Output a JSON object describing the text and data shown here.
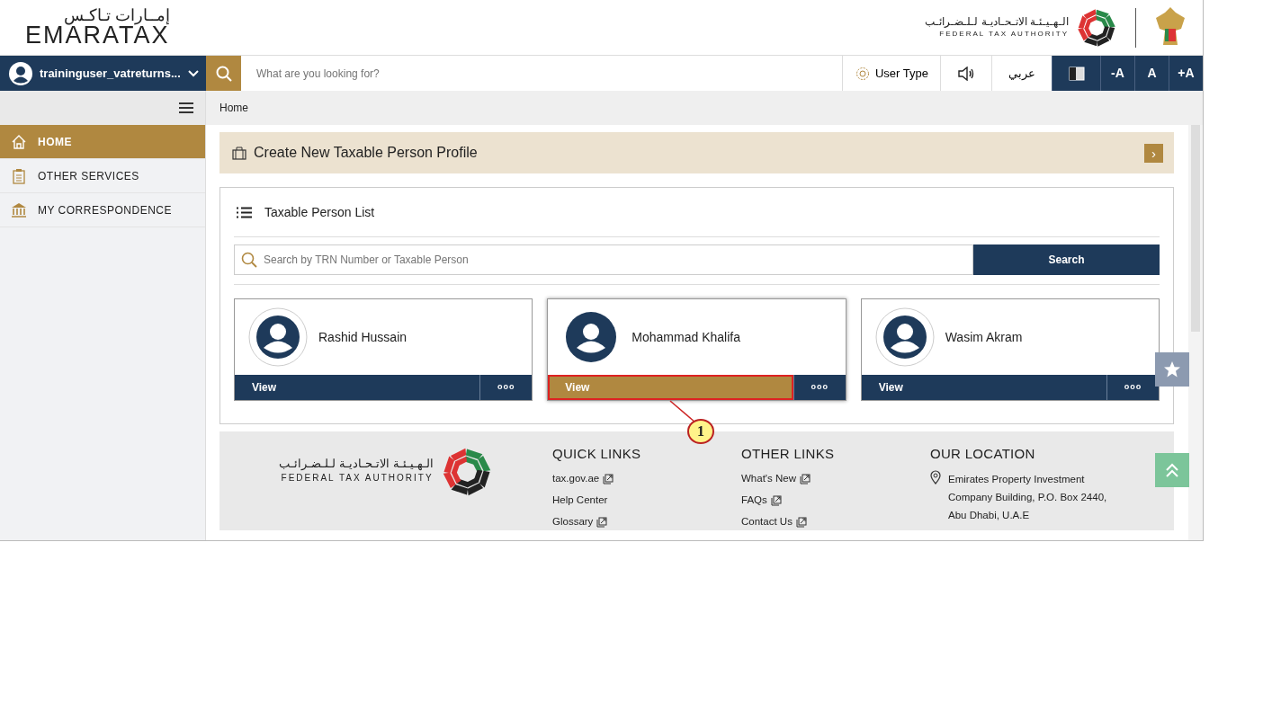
{
  "header": {
    "logo_arabic": "إمــارات تـاكـس",
    "logo_text": "EMARATAX",
    "authority_arabic": "الـهـيـئـة الاتـحـاديـة لـلـضـرائـب",
    "authority_english": "FEDERAL TAX AUTHORITY"
  },
  "toolbar": {
    "user": "traininguser_vatreturns...",
    "search_placeholder": "What are you looking for?",
    "user_type": "User Type",
    "language": "عربي",
    "font_buttons": [
      "-A",
      "A",
      "+A"
    ]
  },
  "breadcrumb": "Home",
  "sidebar": {
    "items": [
      {
        "label": "HOME",
        "selected": true
      },
      {
        "label": "OTHER SERVICES",
        "selected": false
      },
      {
        "label": "MY CORRESPONDENCE",
        "selected": false
      }
    ]
  },
  "create_profile": {
    "label": "Create New Taxable Person Profile",
    "arrow": "›"
  },
  "person_list": {
    "title": "Taxable Person List",
    "search_placeholder": "Search by TRN Number or Taxable Person",
    "search_button": "Search",
    "persons": [
      {
        "name": "Rashid Hussain",
        "action": "View",
        "more": "ooo",
        "selected": false
      },
      {
        "name": "Mohammad Khalifa",
        "action": "View",
        "more": "ooo",
        "selected": true
      },
      {
        "name": "Wasim Akram",
        "action": "View",
        "more": "ooo",
        "selected": false
      }
    ]
  },
  "callout": {
    "number": "1"
  },
  "footer": {
    "authority_arabic": "الـهـيـئـة الاتـحـاديـة لـلـضـرائـب",
    "authority_english": "FEDERAL TAX AUTHORITY",
    "columns": [
      {
        "title": "QUICK LINKS",
        "links": [
          {
            "label": "tax.gov.ae",
            "external": true
          },
          {
            "label": "Help Center",
            "external": false
          },
          {
            "label": "Glossary",
            "external": true
          }
        ]
      },
      {
        "title": "OTHER LINKS",
        "links": [
          {
            "label": "What's New",
            "external": true
          },
          {
            "label": "FAQs",
            "external": true
          },
          {
            "label": "Contact Us",
            "external": true
          }
        ]
      }
    ],
    "location_title": "OUR LOCATION",
    "address": "Emirates Property Investment Company Building, P.O. Box 2440, Abu Dhabi, U.A.E"
  }
}
